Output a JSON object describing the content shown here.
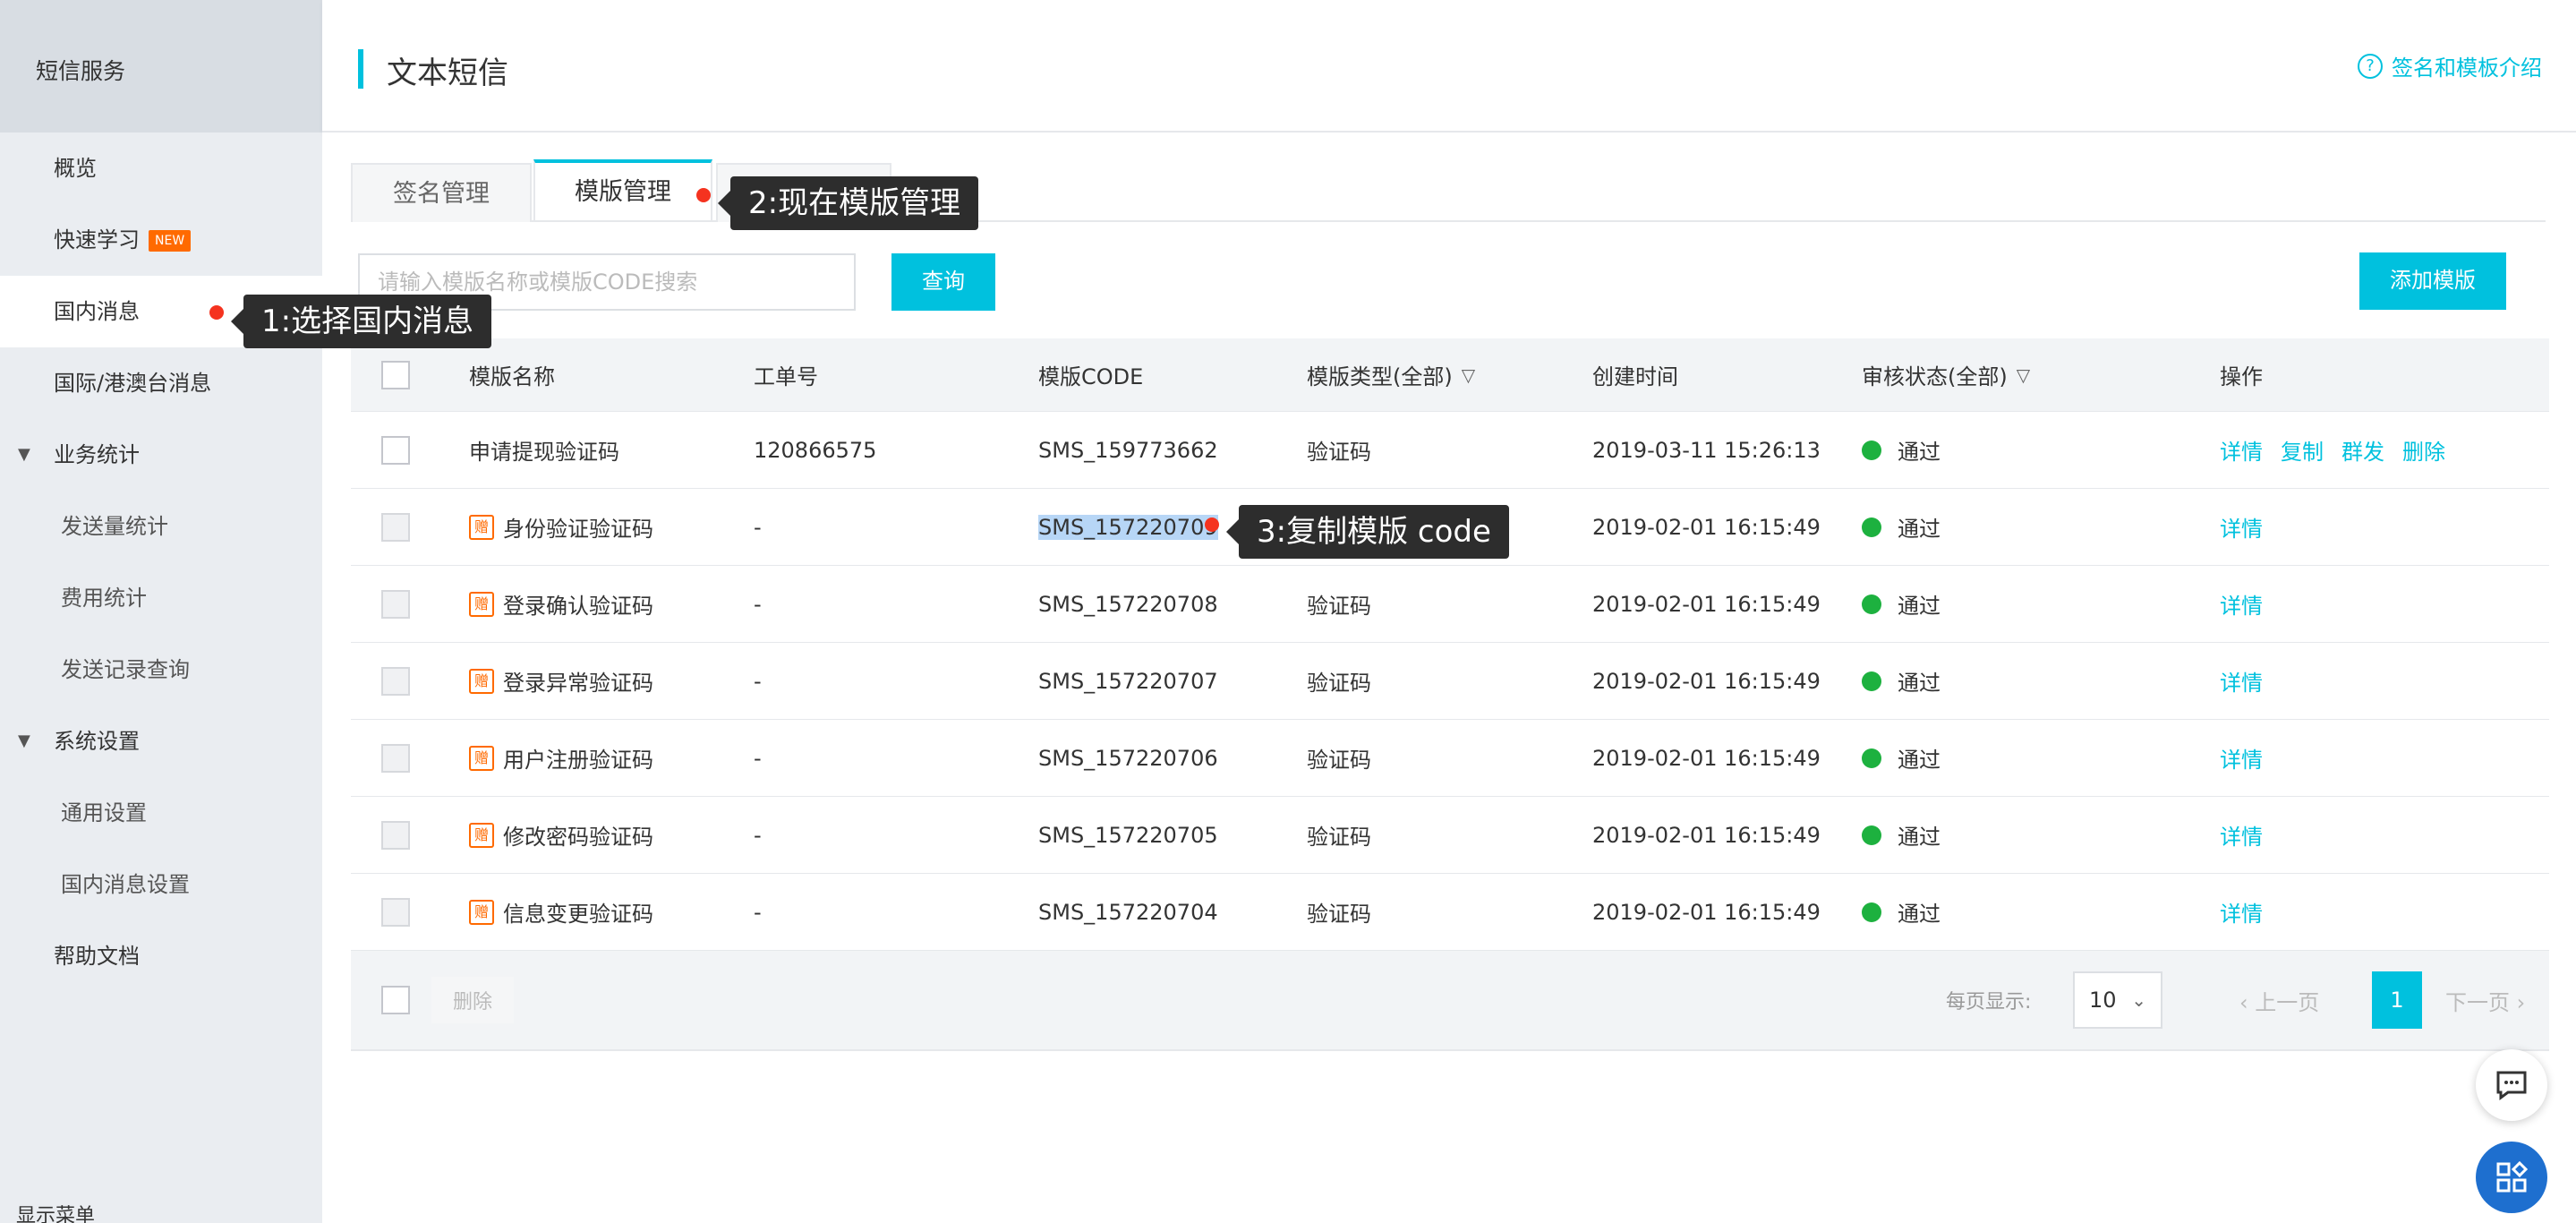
{
  "sidebar": {
    "title": "短信服务",
    "items": [
      {
        "label": "概览"
      },
      {
        "label": "快速学习",
        "badge": "NEW"
      },
      {
        "label": "国内消息"
      },
      {
        "label": "国际/港澳台消息"
      },
      {
        "label": "业务统计"
      },
      {
        "label": "发送量统计"
      },
      {
        "label": "费用统计"
      },
      {
        "label": "发送记录查询"
      },
      {
        "label": "系统设置"
      },
      {
        "label": "通用设置"
      },
      {
        "label": "国内消息设置"
      },
      {
        "label": "帮助文档"
      }
    ],
    "bottom_toggle": "显示菜单"
  },
  "header": {
    "title": "文本短信",
    "help_link": "签名和模板介绍",
    "help_icon": "?"
  },
  "tabs": [
    {
      "label": "签名管理"
    },
    {
      "label": "模版管理"
    }
  ],
  "search": {
    "placeholder": "请输入模版名称或模版CODE搜索",
    "query_label": "查询",
    "add_label": "添加模版"
  },
  "table": {
    "columns": [
      "模版名称",
      "工单号",
      "模版CODE",
      "模版类型(全部)",
      "创建时间",
      "审核状态(全部)",
      "操作"
    ],
    "rows": [
      {
        "name": "申请提现验证码",
        "ticket": "120866575",
        "code": "SMS_159773662",
        "type": "验证码",
        "created": "2019-03-11 15:26:13",
        "status": "通过",
        "actions": [
          "详情",
          "复制",
          "群发",
          "删除"
        ],
        "gift": false
      },
      {
        "name": "身份验证验证码",
        "ticket": "-",
        "code": "SMS_157220709",
        "type": "",
        "created": "2019-02-01 16:15:49",
        "status": "通过",
        "actions": [
          "详情"
        ],
        "gift": true
      },
      {
        "name": "登录确认验证码",
        "ticket": "-",
        "code": "SMS_157220708",
        "type": "验证码",
        "created": "2019-02-01 16:15:49",
        "status": "通过",
        "actions": [
          "详情"
        ],
        "gift": true
      },
      {
        "name": "登录异常验证码",
        "ticket": "-",
        "code": "SMS_157220707",
        "type": "验证码",
        "created": "2019-02-01 16:15:49",
        "status": "通过",
        "actions": [
          "详情"
        ],
        "gift": true
      },
      {
        "name": "用户注册验证码",
        "ticket": "-",
        "code": "SMS_157220706",
        "type": "验证码",
        "created": "2019-02-01 16:15:49",
        "status": "通过",
        "actions": [
          "详情"
        ],
        "gift": true
      },
      {
        "name": "修改密码验证码",
        "ticket": "-",
        "code": "SMS_157220705",
        "type": "验证码",
        "created": "2019-02-01 16:15:49",
        "status": "通过",
        "actions": [
          "详情"
        ],
        "gift": true
      },
      {
        "name": "信息变更验证码",
        "ticket": "-",
        "code": "SMS_157220704",
        "type": "验证码",
        "created": "2019-02-01 16:15:49",
        "status": "通过",
        "actions": [
          "详情"
        ],
        "gift": true
      }
    ],
    "gift_glyph": "赠"
  },
  "footer": {
    "delete_label": "删除",
    "page_size_label": "每页显示:",
    "page_size_value": "10",
    "prev_label": "上一页",
    "current_page": "1",
    "next_label": "下一页"
  },
  "annotations": {
    "step1": "1:选择国内消息",
    "step2": "2:现在模版管理",
    "step3": "3:复制模版 code"
  },
  "colors": {
    "accent": "#00c1de",
    "brand_orange": "#ff6a00",
    "status_green": "#1db13f",
    "annotation_red": "#f5331f"
  }
}
